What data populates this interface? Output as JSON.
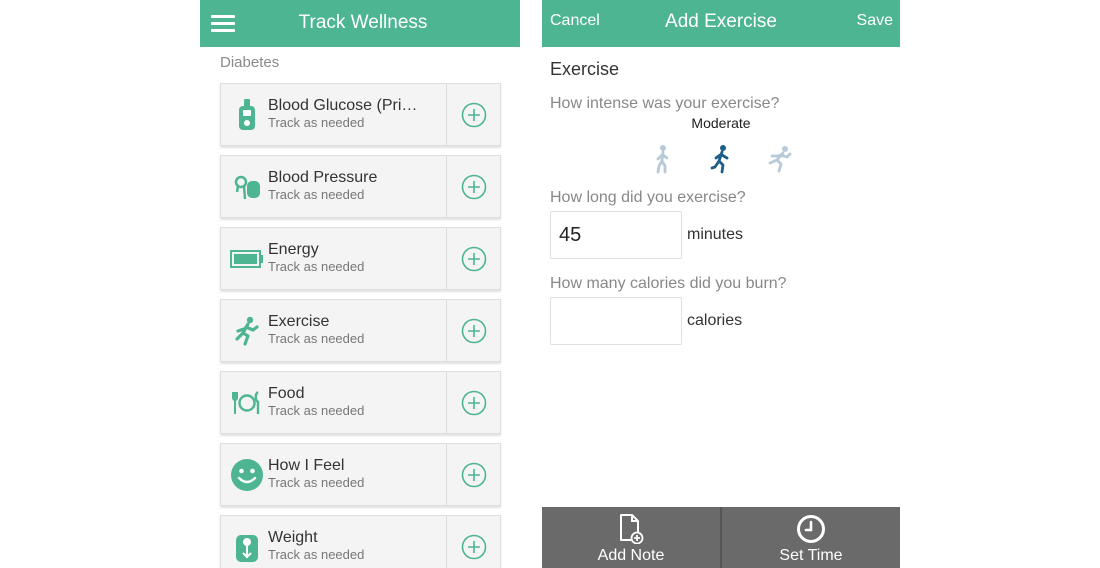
{
  "colors": {
    "accent": "#4db592",
    "bottombar": "#6a6a6a",
    "intensity_active": "#1e5e8a",
    "intensity_inactive": "#b6cad8"
  },
  "left": {
    "title": "Track Wellness",
    "menu_icon": "hamburger-menu-icon",
    "section_label": "Diabetes",
    "items": [
      {
        "name": "Blood Glucose (Pri…",
        "sub": "Track as needed",
        "icon": "glucose-meter-icon"
      },
      {
        "name": "Blood Pressure",
        "sub": "Track as needed",
        "icon": "blood-pressure-cuff-icon"
      },
      {
        "name": "Energy",
        "sub": "Track as needed",
        "icon": "battery-icon"
      },
      {
        "name": "Exercise",
        "sub": "Track as needed",
        "icon": "running-person-icon"
      },
      {
        "name": "Food",
        "sub": "Track as needed",
        "icon": "plate-utensils-icon"
      },
      {
        "name": "How I Feel",
        "sub": "Track as needed",
        "icon": "smiley-face-icon"
      },
      {
        "name": "Weight",
        "sub": "Track as needed",
        "icon": "scale-icon"
      }
    ],
    "add_icon": "plus-circle-icon"
  },
  "right": {
    "cancel": "Cancel",
    "title": "Add Exercise",
    "save": "Save",
    "heading": "Exercise",
    "intensity_question": "How intense was your exercise?",
    "intensity_value": "Moderate",
    "intensity_options": [
      "walking-person-icon",
      "running-person-icon",
      "sprinting-person-icon"
    ],
    "duration_question": "How long did you exercise?",
    "duration_value": "45",
    "duration_unit": "minutes",
    "calories_question": "How many calories did you burn?",
    "calories_value": "",
    "calories_unit": "calories",
    "bottom": {
      "add_note": "Add Note",
      "add_note_icon": "add-note-icon",
      "set_time": "Set Time",
      "set_time_icon": "clock-icon"
    }
  }
}
